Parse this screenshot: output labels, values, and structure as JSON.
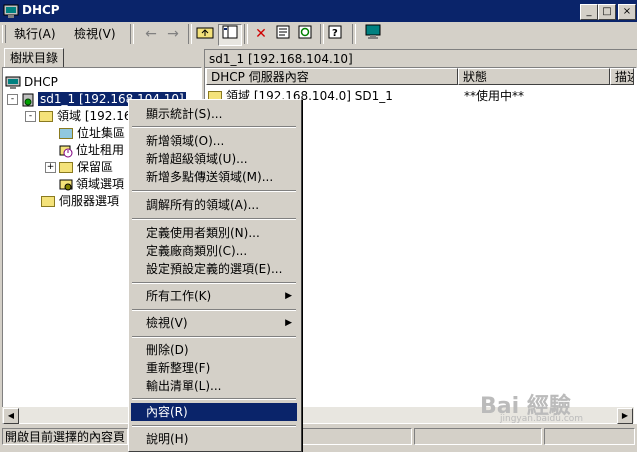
{
  "window": {
    "title": "DHCP"
  },
  "menubar": {
    "action": "執行(A)",
    "view": "檢視(V)"
  },
  "toolbar": {
    "icons": [
      "back-icon",
      "forward-icon",
      "up-folder-icon",
      "show-tree-icon",
      "delete-icon",
      "properties-icon",
      "refresh-icon",
      "help-icon",
      "console-icon"
    ]
  },
  "left_tab": "樹狀目錄",
  "right_header": "sd1_1 [192.168.104.10]",
  "columns": [
    "DHCP 伺服器內容",
    "狀態",
    "描述"
  ],
  "rows": [
    {
      "content": "領域 [192.168.104.0] SD1_1",
      "status": "**使用中**"
    }
  ],
  "tree": {
    "root": "DHCP",
    "server": "sd1_1 [192.168.104.10]",
    "scope": "領域 [192.16",
    "pool": "位址集區",
    "leases": "位址租用",
    "reservations": "保留區",
    "scope_options": "領域選項",
    "server_options": "伺服器選項"
  },
  "context_menu": {
    "stats": "顯示統計(S)...",
    "new_scope": "新增領域(O)...",
    "new_superscope": "新增超級領域(U)...",
    "new_multicast": "新增多點傳送領域(M)...",
    "reconcile": "調解所有的領域(A)...",
    "user_classes": "定義使用者類別(N)...",
    "vendor_classes": "定義廠商類別(C)...",
    "predefined": "設定預設定義的選項(E)...",
    "all_tasks": "所有工作(K)",
    "view": "檢視(V)",
    "delete": "刪除(D)",
    "refresh": "重新整理(F)",
    "export": "輸出清單(L)...",
    "properties": "內容(R)",
    "help": "說明(H)"
  },
  "status": {
    "text": "開啟目前選擇的內容頁"
  },
  "watermark": {
    "brand": "Bai 經驗",
    "url": "jingyan.baidu.com"
  }
}
